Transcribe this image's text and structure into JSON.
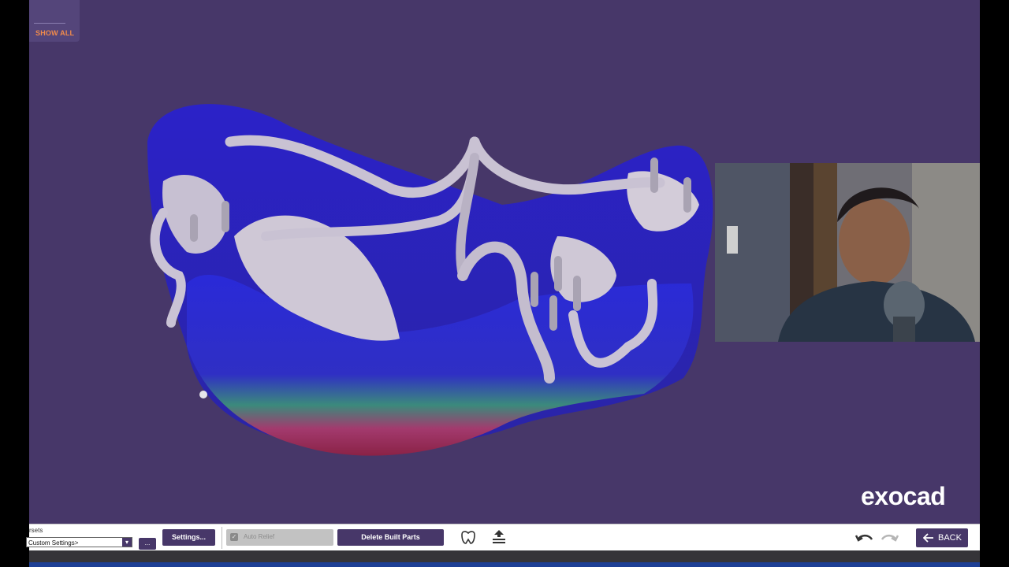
{
  "viewport": {
    "show_all_label": "SHOW ALL",
    "logo": "exocad"
  },
  "toolbar": {
    "presets_label": "rsets",
    "presets_value": "Custom Settings>",
    "more_label": "...",
    "settings_label": "Settings...",
    "auto_relief_label": "Auto Relief",
    "auto_relief_checked": true,
    "delete_label": "Delete Built Parts",
    "back_label": "BACK"
  },
  "icons": [
    "crown-icon",
    "upload-layers-icon",
    "undo-icon",
    "redo-icon",
    "back-arrow-icon"
  ],
  "colors": {
    "background": "#473769",
    "button": "#473769",
    "accent": "#f08a4b"
  }
}
